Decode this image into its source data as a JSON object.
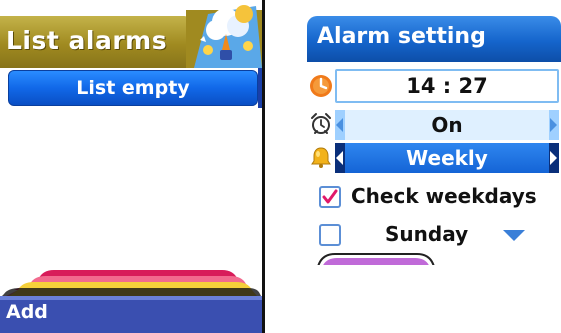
{
  "list_alarms": {
    "title": "List alarms",
    "empty_item": "List empty",
    "softkey_left": "Add"
  },
  "alarm_setting": {
    "title": "Alarm setting",
    "time": "14 : 27",
    "state": "On",
    "repeat": "Weekly",
    "check_weekdays_label": "Check weekdays",
    "check_weekdays_checked": true,
    "weekday_label": "Sunday",
    "weekday_checked": false
  },
  "icons": {
    "time_row": "clock-icon",
    "state_row": "alarm-clock-icon",
    "repeat_row": "bell-icon",
    "header_art": "weather-decoration-icon"
  },
  "colors": {
    "left_title_bar": "#a08a20",
    "selection_blue": "#1168e8",
    "title_blue": "#1565cc",
    "softkey_bar": "#3a4fb0"
  }
}
